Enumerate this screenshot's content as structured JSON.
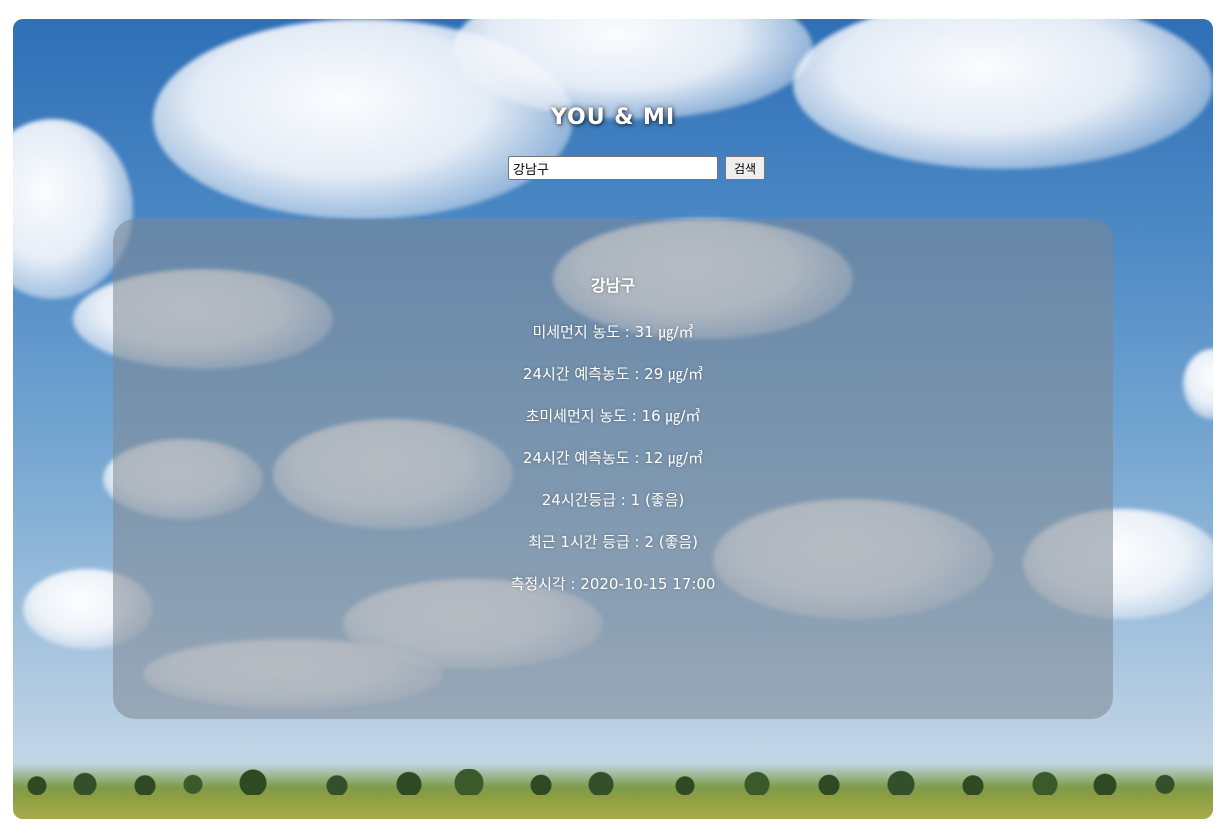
{
  "header": {
    "title": "YOU & MI"
  },
  "search": {
    "value": "강남구",
    "button_label": "검색"
  },
  "result": {
    "district": "강남구",
    "lines": [
      "미세먼지 농도 : 31 ㎍/㎥",
      "24시간 예측농도 : 29 ㎍/㎥",
      "초미세먼지 농도 : 16 ㎍/㎥",
      "24시간 예측농도 : 12 ㎍/㎥",
      "24시간등급 : 1 (좋음)",
      "최근 1시간 등급 : 2 (좋음)",
      "측정시각 : 2020-10-15 17:00"
    ]
  }
}
